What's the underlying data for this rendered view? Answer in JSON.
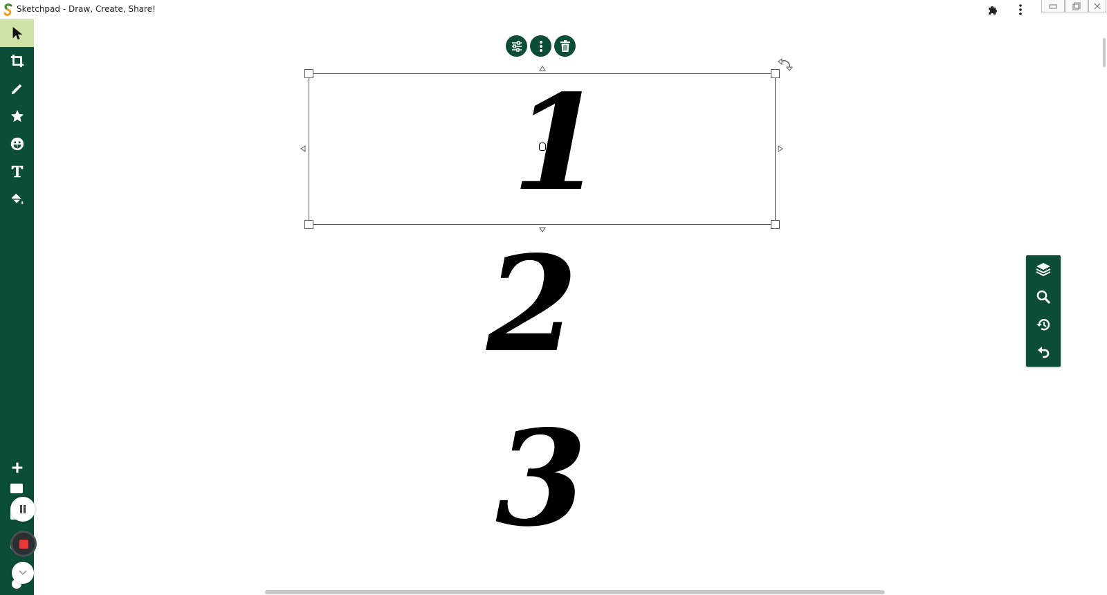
{
  "window": {
    "title": "Sketchpad - Draw, Create, Share!"
  },
  "canvas": {
    "numerals": [
      "1",
      "2",
      "3"
    ]
  },
  "colors": {
    "sidebar": "#0b4d36",
    "active_tool": "#cfe3a8",
    "record_stop": "#e53935"
  },
  "icons": {
    "left_tools": [
      "select-arrow-icon",
      "crop-icon",
      "pencil-icon",
      "star-icon",
      "emoji-icon",
      "text-icon",
      "paint-bucket-icon",
      "add-icon"
    ],
    "context": [
      "adjust-icon",
      "more-vertical-icon",
      "trash-icon"
    ],
    "right_panel": [
      "layers-icon",
      "search-icon",
      "history-icon",
      "undo-icon"
    ]
  }
}
